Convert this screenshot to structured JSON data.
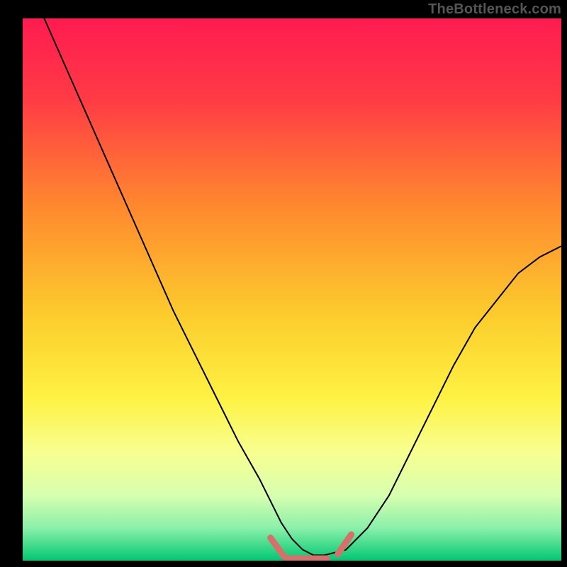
{
  "watermark": "TheBottleneck.com",
  "chart_data": {
    "type": "line",
    "title": "",
    "xlabel": "",
    "ylabel": "",
    "xlim": [
      0,
      100
    ],
    "ylim": [
      0,
      100
    ],
    "legend": false,
    "grid": false,
    "background_gradient": [
      {
        "offset": 0.0,
        "color": "#ff1b50"
      },
      {
        "offset": 0.15,
        "color": "#ff3b45"
      },
      {
        "offset": 0.35,
        "color": "#ff8a2e"
      },
      {
        "offset": 0.55,
        "color": "#fccd2d"
      },
      {
        "offset": 0.7,
        "color": "#fef243"
      },
      {
        "offset": 0.8,
        "color": "#f8ff90"
      },
      {
        "offset": 0.88,
        "color": "#d7ffb0"
      },
      {
        "offset": 0.94,
        "color": "#8af0a9"
      },
      {
        "offset": 1.0,
        "color": "#00c873"
      }
    ],
    "series": [
      {
        "name": "curve",
        "color": "#000000",
        "stroke_width": 2,
        "x": [
          4,
          8,
          12,
          16,
          20,
          24,
          28,
          32,
          36,
          40,
          44,
          46,
          48,
          50,
          52,
          54,
          56,
          60,
          64,
          68,
          72,
          76,
          80,
          84,
          88,
          92,
          96,
          100
        ],
        "y": [
          100,
          91,
          82,
          73,
          64,
          55,
          46,
          38,
          30,
          22,
          15,
          11,
          7,
          4,
          2,
          1,
          1,
          2,
          6,
          12,
          20,
          28,
          36,
          43,
          48,
          53,
          56,
          58
        ]
      },
      {
        "name": "left-short-tick",
        "color": "#d6706a",
        "stroke_width": 9,
        "linecap": "round",
        "x": [
          46,
          48.5
        ],
        "y": [
          4.2,
          0.8
        ]
      },
      {
        "name": "bottom-flat-tick",
        "color": "#d6706a",
        "stroke_width": 9,
        "linecap": "round",
        "x": [
          49,
          56.5
        ],
        "y": [
          0.4,
          0.4
        ]
      },
      {
        "name": "right-short-tick",
        "color": "#d6706a",
        "stroke_width": 9,
        "linecap": "round",
        "x": [
          58.5,
          61
        ],
        "y": [
          1.2,
          4.8
        ]
      }
    ]
  }
}
